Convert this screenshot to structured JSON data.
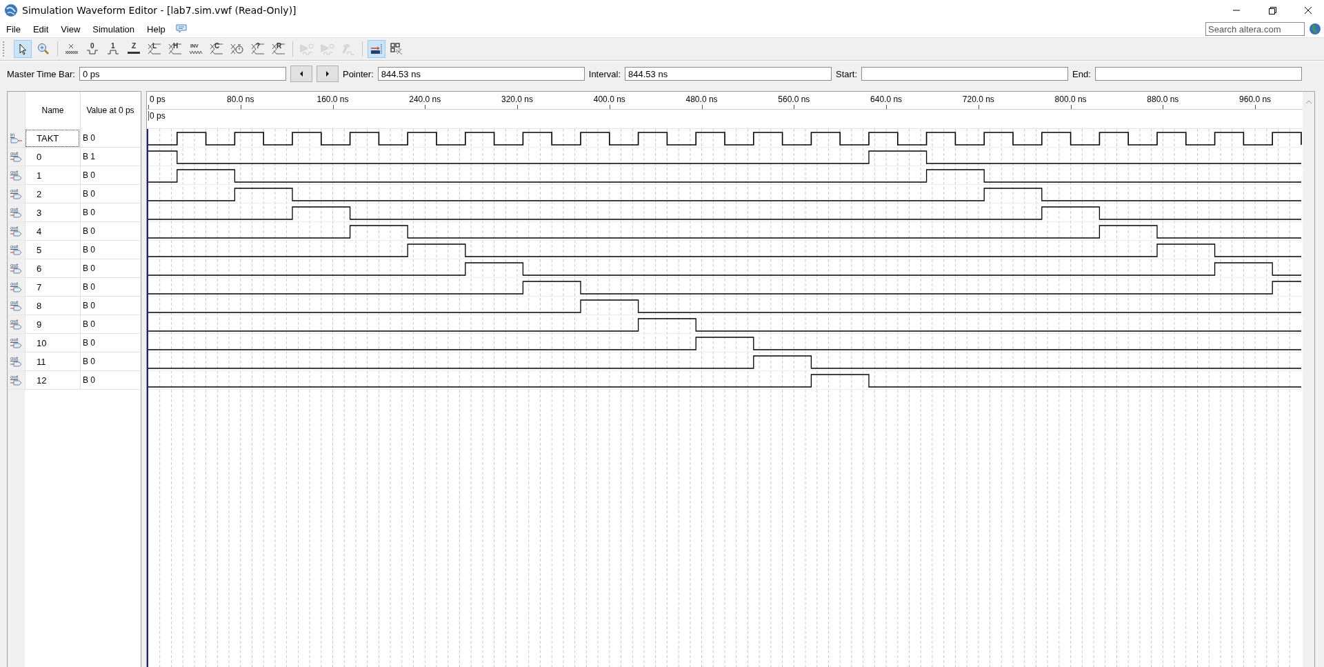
{
  "window": {
    "title": "Simulation Waveform Editor - [lab7.sim.vwf (Read-Only)]"
  },
  "menu": [
    {
      "label": "File"
    },
    {
      "label": "Edit"
    },
    {
      "label": "View"
    },
    {
      "label": "Simulation"
    },
    {
      "label": "Help"
    }
  ],
  "search": {
    "placeholder": "Search altera.com"
  },
  "toolbar": [
    {
      "kind": "select",
      "pressed": true,
      "disabled": false
    },
    {
      "kind": "zoom",
      "pressed": false,
      "disabled": false
    },
    {
      "kind": "unknown",
      "pressed": false,
      "disabled": false
    },
    {
      "kind": "low",
      "glyph": "0",
      "pressed": false,
      "disabled": false
    },
    {
      "kind": "high",
      "glyph": "1",
      "pressed": false,
      "disabled": false
    },
    {
      "kind": "highz",
      "glyph": "Z",
      "pressed": false,
      "disabled": false
    },
    {
      "kind": "bus",
      "glyph": "L",
      "pressed": false,
      "disabled": false
    },
    {
      "kind": "bus",
      "glyph": "H",
      "pressed": false,
      "disabled": false
    },
    {
      "kind": "invert",
      "glyph": "INV",
      "pressed": false,
      "disabled": false
    },
    {
      "kind": "bus",
      "glyph": "C",
      "pressed": false,
      "disabled": false
    },
    {
      "kind": "timer",
      "pressed": false,
      "disabled": false
    },
    {
      "kind": "bus",
      "glyph": "?",
      "pressed": false,
      "disabled": false
    },
    {
      "kind": "bus",
      "glyph": "R",
      "pressed": false,
      "disabled": false
    },
    {
      "kind": "run",
      "pressed": false,
      "disabled": true
    },
    {
      "kind": "run",
      "pressed": false,
      "disabled": true
    },
    {
      "kind": "hammer",
      "pressed": false,
      "disabled": true
    },
    {
      "kind": "snap",
      "pressed": true,
      "disabled": false
    },
    {
      "kind": "grid",
      "pressed": false,
      "disabled": false
    }
  ],
  "time_bar": {
    "master_label": "Master Time Bar:",
    "master_value": "0 ps",
    "pointer_label": "Pointer:",
    "pointer_value": "844.53 ns",
    "interval_label": "Interval:",
    "interval_value": "844.53 ns",
    "start_label": "Start:",
    "end_label": "End:"
  },
  "signals_table": {
    "columns": [
      {
        "label": "Name"
      },
      {
        "label": "Value at 0 ps"
      }
    ],
    "rows": [
      {
        "kind": "input",
        "pin": "in",
        "name": "TAKT",
        "value": "B 0",
        "focused": true
      },
      {
        "kind": "output",
        "pin": "out",
        "name": "0",
        "value": "B 1",
        "focused": false
      },
      {
        "kind": "output",
        "pin": "out",
        "name": "1",
        "value": "B 0",
        "focused": false
      },
      {
        "kind": "output",
        "pin": "out",
        "name": "2",
        "value": "B 0",
        "focused": false
      },
      {
        "kind": "output",
        "pin": "out",
        "name": "3",
        "value": "B 0",
        "focused": false
      },
      {
        "kind": "output",
        "pin": "out",
        "name": "4",
        "value": "B 0",
        "focused": false
      },
      {
        "kind": "output",
        "pin": "out",
        "name": "5",
        "value": "B 0",
        "focused": false
      },
      {
        "kind": "output",
        "pin": "out",
        "name": "6",
        "value": "B 0",
        "focused": false
      },
      {
        "kind": "output",
        "pin": "out",
        "name": "7",
        "value": "B 0",
        "focused": false
      },
      {
        "kind": "output",
        "pin": "out",
        "name": "8",
        "value": "B 0",
        "focused": false
      },
      {
        "kind": "output",
        "pin": "out",
        "name": "9",
        "value": "B 0",
        "focused": false
      },
      {
        "kind": "output",
        "pin": "out",
        "name": "10",
        "value": "B 0",
        "focused": false
      },
      {
        "kind": "output",
        "pin": "out",
        "name": "11",
        "value": "B 0",
        "focused": false
      },
      {
        "kind": "output",
        "pin": "out",
        "name": "12",
        "value": "B 0",
        "focused": false
      }
    ]
  },
  "waveform": {
    "time_bar_label": "0 ps",
    "ruler": [
      {
        "label": "0 ps"
      },
      {
        "label": "80.0 ns"
      },
      {
        "label": "160.0 ns"
      },
      {
        "label": "240.0 ns"
      },
      {
        "label": "320.0 ns"
      },
      {
        "label": "400.0 ns"
      },
      {
        "label": "480.0 ns"
      },
      {
        "label": "560.0 ns"
      },
      {
        "label": "640.0 ns"
      },
      {
        "label": "720.0 ns"
      },
      {
        "label": "800.0 ns"
      },
      {
        "label": "880.0 ns"
      },
      {
        "label": "960.0 ns"
      }
    ]
  }
}
